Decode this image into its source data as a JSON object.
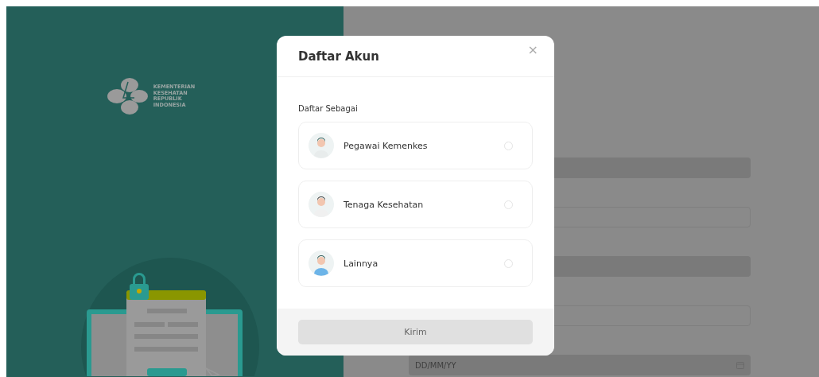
{
  "brand": {
    "lines": [
      "KEMENTERIAN",
      "KESEHATAN",
      "REPUBLIK",
      "INDONESIA"
    ]
  },
  "background_form": {
    "fields": [
      {
        "kind": "filled"
      },
      {
        "kind": "outlined"
      },
      {
        "kind": "filled"
      },
      {
        "kind": "outlined"
      },
      {
        "kind": "date",
        "placeholder": "DD/MM/YY"
      }
    ]
  },
  "dialog": {
    "title": "Daftar Akun",
    "close": "×",
    "section_label": "Daftar Sebagai",
    "options": [
      {
        "label": "Pegawai Kemenkes",
        "kind": "employee",
        "selected": false
      },
      {
        "label": "Tenaga Kesehatan",
        "kind": "health-worker",
        "selected": false
      },
      {
        "label": "Lainnya",
        "kind": "other",
        "selected": false
      }
    ],
    "submit": {
      "label": "Kirim",
      "disabled": true
    }
  }
}
